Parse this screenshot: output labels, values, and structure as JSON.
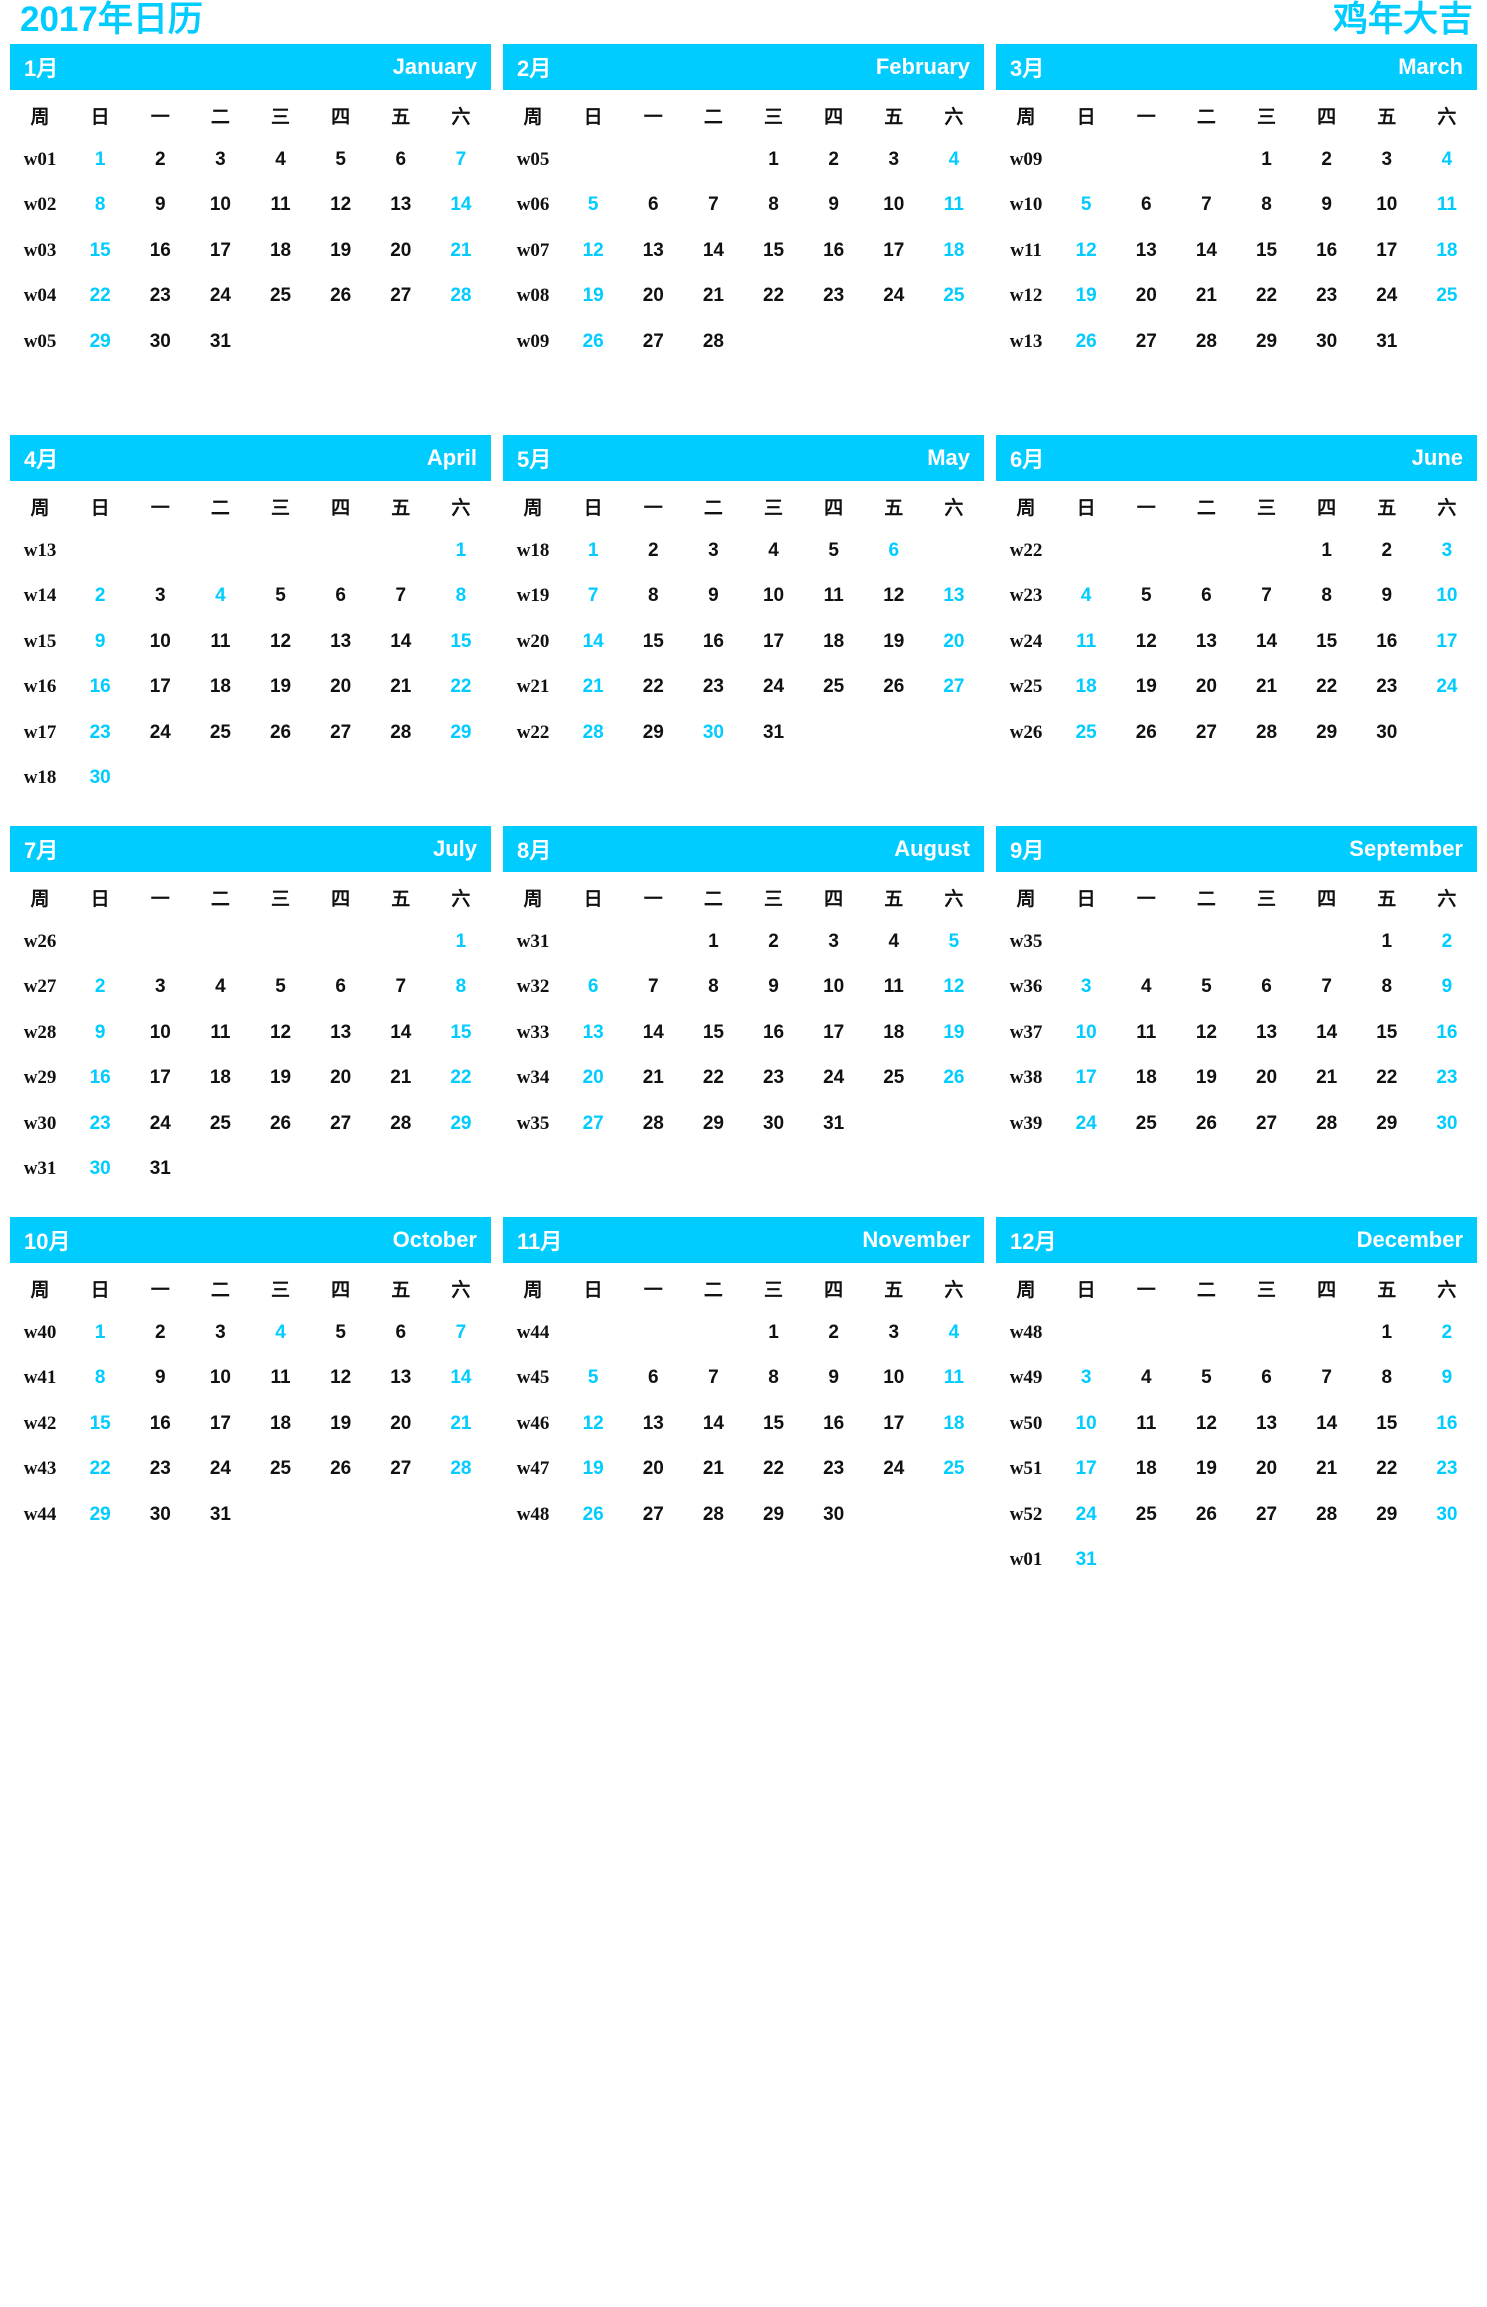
{
  "header": {
    "title_left": "2017年日历",
    "title_right": "鸡年大吉",
    "accent_color": "#00ccff",
    "text_color": "#111111"
  },
  "dow_header": {
    "week_label": "周",
    "days": [
      {
        "label": "日",
        "weekend": true
      },
      {
        "label": "一",
        "weekend": false
      },
      {
        "label": "二",
        "weekend": false
      },
      {
        "label": "三",
        "weekend": false
      },
      {
        "label": "四",
        "weekend": false
      },
      {
        "label": "五",
        "weekend": false
      },
      {
        "label": "六",
        "weekend": true
      }
    ]
  },
  "months": [
    {
      "cn": "1月",
      "en": "January",
      "rows": [
        {
          "week": "w01",
          "days": [
            "1",
            "2",
            "3",
            "4",
            "5",
            "6",
            "7"
          ],
          "hl": [
            0,
            6
          ]
        },
        {
          "week": "w02",
          "days": [
            "8",
            "9",
            "10",
            "11",
            "12",
            "13",
            "14"
          ],
          "hl": [
            0,
            6
          ]
        },
        {
          "week": "w03",
          "days": [
            "15",
            "16",
            "17",
            "18",
            "19",
            "20",
            "21"
          ],
          "hl": [
            0,
            6
          ]
        },
        {
          "week": "w04",
          "days": [
            "22",
            "23",
            "24",
            "25",
            "26",
            "27",
            "28"
          ],
          "hl": [
            0,
            6
          ]
        },
        {
          "week": "w05",
          "days": [
            "29",
            "30",
            "31",
            "",
            "",
            "",
            ""
          ],
          "hl": [
            0
          ]
        },
        {
          "week": "",
          "days": [
            "",
            "",
            "",
            "",
            "",
            "",
            ""
          ],
          "hl": []
        }
      ]
    },
    {
      "cn": "2月",
      "en": "February",
      "rows": [
        {
          "week": "w05",
          "days": [
            "",
            "",
            "",
            "1",
            "2",
            "3",
            "4"
          ],
          "hl": [
            6
          ]
        },
        {
          "week": "w06",
          "days": [
            "5",
            "6",
            "7",
            "8",
            "9",
            "10",
            "11"
          ],
          "hl": [
            0,
            6
          ]
        },
        {
          "week": "w07",
          "days": [
            "12",
            "13",
            "14",
            "15",
            "16",
            "17",
            "18"
          ],
          "hl": [
            0,
            6
          ]
        },
        {
          "week": "w08",
          "days": [
            "19",
            "20",
            "21",
            "22",
            "23",
            "24",
            "25"
          ],
          "hl": [
            0,
            6
          ]
        },
        {
          "week": "w09",
          "days": [
            "26",
            "27",
            "28",
            "",
            "",
            "",
            ""
          ],
          "hl": [
            0
          ]
        },
        {
          "week": "",
          "days": [
            "",
            "",
            "",
            "",
            "",
            "",
            ""
          ],
          "hl": []
        }
      ]
    },
    {
      "cn": "3月",
      "en": "March",
      "rows": [
        {
          "week": "w09",
          "days": [
            "",
            "",
            "",
            "1",
            "2",
            "3",
            "4"
          ],
          "hl": [
            6
          ]
        },
        {
          "week": "w10",
          "days": [
            "5",
            "6",
            "7",
            "8",
            "9",
            "10",
            "11"
          ],
          "hl": [
            0,
            6
          ]
        },
        {
          "week": "w11",
          "days": [
            "12",
            "13",
            "14",
            "15",
            "16",
            "17",
            "18"
          ],
          "hl": [
            0,
            6
          ]
        },
        {
          "week": "w12",
          "days": [
            "19",
            "20",
            "21",
            "22",
            "23",
            "24",
            "25"
          ],
          "hl": [
            0,
            6
          ]
        },
        {
          "week": "w13",
          "days": [
            "26",
            "27",
            "28",
            "29",
            "30",
            "31",
            ""
          ],
          "hl": [
            0
          ]
        },
        {
          "week": "",
          "days": [
            "",
            "",
            "",
            "",
            "",
            "",
            ""
          ],
          "hl": []
        }
      ]
    },
    {
      "cn": "4月",
      "en": "April",
      "rows": [
        {
          "week": "w13",
          "days": [
            "",
            "",
            "",
            "",
            "",
            "",
            "1"
          ],
          "hl": [
            6
          ]
        },
        {
          "week": "w14",
          "days": [
            "2",
            "3",
            "4",
            "5",
            "6",
            "7",
            "8"
          ],
          "hl": [
            0,
            2,
            6
          ]
        },
        {
          "week": "w15",
          "days": [
            "9",
            "10",
            "11",
            "12",
            "13",
            "14",
            "15"
          ],
          "hl": [
            0,
            6
          ]
        },
        {
          "week": "w16",
          "days": [
            "16",
            "17",
            "18",
            "19",
            "20",
            "21",
            "22"
          ],
          "hl": [
            0,
            6
          ]
        },
        {
          "week": "w17",
          "days": [
            "23",
            "24",
            "25",
            "26",
            "27",
            "28",
            "29"
          ],
          "hl": [
            0,
            6
          ]
        },
        {
          "week": "w18",
          "days": [
            "30",
            "",
            "",
            "",
            "",
            "",
            ""
          ],
          "hl": [
            0
          ]
        }
      ]
    },
    {
      "cn": "5月",
      "en": "May",
      "rows": [
        {
          "week": "w18",
          "days": [
            "1",
            "2",
            "3",
            "4",
            "5",
            "6",
            ""
          ],
          "hl": [
            0,
            5
          ]
        },
        {
          "week": "w19",
          "days": [
            "7",
            "8",
            "9",
            "10",
            "11",
            "12",
            "13"
          ],
          "hl": [
            0,
            6
          ]
        },
        {
          "week": "w20",
          "days": [
            "14",
            "15",
            "16",
            "17",
            "18",
            "19",
            "20"
          ],
          "hl": [
            0,
            6
          ]
        },
        {
          "week": "w21",
          "days": [
            "21",
            "22",
            "23",
            "24",
            "25",
            "26",
            "27"
          ],
          "hl": [
            0,
            6
          ]
        },
        {
          "week": "w22",
          "days": [
            "28",
            "29",
            "30",
            "31",
            "",
            "",
            ""
          ],
          "hl": [
            0,
            2
          ]
        },
        {
          "week": "",
          "days": [
            "",
            "",
            "",
            "",
            "",
            "",
            ""
          ],
          "hl": []
        }
      ]
    },
    {
      "cn": "6月",
      "en": "June",
      "rows": [
        {
          "week": "w22",
          "days": [
            "",
            "",
            "",
            "",
            "1",
            "2",
            "3"
          ],
          "hl": [
            6
          ]
        },
        {
          "week": "w23",
          "days": [
            "4",
            "5",
            "6",
            "7",
            "8",
            "9",
            "10"
          ],
          "hl": [
            0,
            6
          ]
        },
        {
          "week": "w24",
          "days": [
            "11",
            "12",
            "13",
            "14",
            "15",
            "16",
            "17"
          ],
          "hl": [
            0,
            6
          ]
        },
        {
          "week": "w25",
          "days": [
            "18",
            "19",
            "20",
            "21",
            "22",
            "23",
            "24"
          ],
          "hl": [
            0,
            6
          ]
        },
        {
          "week": "w26",
          "days": [
            "25",
            "26",
            "27",
            "28",
            "29",
            "30",
            ""
          ],
          "hl": [
            0
          ]
        },
        {
          "week": "",
          "days": [
            "",
            "",
            "",
            "",
            "",
            "",
            ""
          ],
          "hl": []
        }
      ]
    },
    {
      "cn": "7月",
      "en": "July",
      "rows": [
        {
          "week": "w26",
          "days": [
            "",
            "",
            "",
            "",
            "",
            "",
            "1"
          ],
          "hl": [
            6
          ]
        },
        {
          "week": "w27",
          "days": [
            "2",
            "3",
            "4",
            "5",
            "6",
            "7",
            "8"
          ],
          "hl": [
            0,
            6
          ]
        },
        {
          "week": "w28",
          "days": [
            "9",
            "10",
            "11",
            "12",
            "13",
            "14",
            "15"
          ],
          "hl": [
            0,
            6
          ]
        },
        {
          "week": "w29",
          "days": [
            "16",
            "17",
            "18",
            "19",
            "20",
            "21",
            "22"
          ],
          "hl": [
            0,
            6
          ]
        },
        {
          "week": "w30",
          "days": [
            "23",
            "24",
            "25",
            "26",
            "27",
            "28",
            "29"
          ],
          "hl": [
            0,
            6
          ]
        },
        {
          "week": "w31",
          "days": [
            "30",
            "31",
            "",
            "",
            "",
            "",
            ""
          ],
          "hl": [
            0
          ]
        }
      ]
    },
    {
      "cn": "8月",
      "en": "August",
      "rows": [
        {
          "week": "w31",
          "days": [
            "",
            "",
            "1",
            "2",
            "3",
            "4",
            "5"
          ],
          "hl": [
            6
          ]
        },
        {
          "week": "w32",
          "days": [
            "6",
            "7",
            "8",
            "9",
            "10",
            "11",
            "12"
          ],
          "hl": [
            0,
            6
          ]
        },
        {
          "week": "w33",
          "days": [
            "13",
            "14",
            "15",
            "16",
            "17",
            "18",
            "19"
          ],
          "hl": [
            0,
            6
          ]
        },
        {
          "week": "w34",
          "days": [
            "20",
            "21",
            "22",
            "23",
            "24",
            "25",
            "26"
          ],
          "hl": [
            0,
            6
          ]
        },
        {
          "week": "w35",
          "days": [
            "27",
            "28",
            "29",
            "30",
            "31",
            "",
            ""
          ],
          "hl": [
            0
          ]
        },
        {
          "week": "",
          "days": [
            "",
            "",
            "",
            "",
            "",
            "",
            ""
          ],
          "hl": []
        }
      ]
    },
    {
      "cn": "9月",
      "en": "September",
      "rows": [
        {
          "week": "w35",
          "days": [
            "",
            "",
            "",
            "",
            "",
            "1",
            "2"
          ],
          "hl": [
            6
          ]
        },
        {
          "week": "w36",
          "days": [
            "3",
            "4",
            "5",
            "6",
            "7",
            "8",
            "9"
          ],
          "hl": [
            0,
            6
          ]
        },
        {
          "week": "w37",
          "days": [
            "10",
            "11",
            "12",
            "13",
            "14",
            "15",
            "16"
          ],
          "hl": [
            0,
            6
          ]
        },
        {
          "week": "w38",
          "days": [
            "17",
            "18",
            "19",
            "20",
            "21",
            "22",
            "23"
          ],
          "hl": [
            0,
            6
          ]
        },
        {
          "week": "w39",
          "days": [
            "24",
            "25",
            "26",
            "27",
            "28",
            "29",
            "30"
          ],
          "hl": [
            0,
            6
          ]
        },
        {
          "week": "",
          "days": [
            "",
            "",
            "",
            "",
            "",
            "",
            ""
          ],
          "hl": []
        }
      ]
    },
    {
      "cn": "10月",
      "en": "October",
      "rows": [
        {
          "week": "w40",
          "days": [
            "1",
            "2",
            "3",
            "4",
            "5",
            "6",
            "7"
          ],
          "hl": [
            0,
            3,
            6
          ]
        },
        {
          "week": "w41",
          "days": [
            "8",
            "9",
            "10",
            "11",
            "12",
            "13",
            "14"
          ],
          "hl": [
            0,
            6
          ]
        },
        {
          "week": "w42",
          "days": [
            "15",
            "16",
            "17",
            "18",
            "19",
            "20",
            "21"
          ],
          "hl": [
            0,
            6
          ]
        },
        {
          "week": "w43",
          "days": [
            "22",
            "23",
            "24",
            "25",
            "26",
            "27",
            "28"
          ],
          "hl": [
            0,
            6
          ]
        },
        {
          "week": "w44",
          "days": [
            "29",
            "30",
            "31",
            "",
            "",
            "",
            ""
          ],
          "hl": [
            0
          ]
        },
        {
          "week": "",
          "days": [
            "",
            "",
            "",
            "",
            "",
            "",
            ""
          ],
          "hl": []
        }
      ]
    },
    {
      "cn": "11月",
      "en": "November",
      "rows": [
        {
          "week": "w44",
          "days": [
            "",
            "",
            "",
            "1",
            "2",
            "3",
            "4"
          ],
          "hl": [
            6
          ]
        },
        {
          "week": "w45",
          "days": [
            "5",
            "6",
            "7",
            "8",
            "9",
            "10",
            "11"
          ],
          "hl": [
            0,
            6
          ]
        },
        {
          "week": "w46",
          "days": [
            "12",
            "13",
            "14",
            "15",
            "16",
            "17",
            "18"
          ],
          "hl": [
            0,
            6
          ]
        },
        {
          "week": "w47",
          "days": [
            "19",
            "20",
            "21",
            "22",
            "23",
            "24",
            "25"
          ],
          "hl": [
            0,
            6
          ]
        },
        {
          "week": "w48",
          "days": [
            "26",
            "27",
            "28",
            "29",
            "30",
            "",
            ""
          ],
          "hl": [
            0
          ]
        },
        {
          "week": "",
          "days": [
            "",
            "",
            "",
            "",
            "",
            "",
            ""
          ],
          "hl": []
        }
      ]
    },
    {
      "cn": "12月",
      "en": "December",
      "rows": [
        {
          "week": "w48",
          "days": [
            "",
            "",
            "",
            "",
            "",
            "1",
            "2"
          ],
          "hl": [
            6
          ]
        },
        {
          "week": "w49",
          "days": [
            "3",
            "4",
            "5",
            "6",
            "7",
            "8",
            "9"
          ],
          "hl": [
            0,
            6
          ]
        },
        {
          "week": "w50",
          "days": [
            "10",
            "11",
            "12",
            "13",
            "14",
            "15",
            "16"
          ],
          "hl": [
            0,
            6
          ]
        },
        {
          "week": "w51",
          "days": [
            "17",
            "18",
            "19",
            "20",
            "21",
            "22",
            "23"
          ],
          "hl": [
            0,
            6
          ]
        },
        {
          "week": "w52",
          "days": [
            "24",
            "25",
            "26",
            "27",
            "28",
            "29",
            "30"
          ],
          "hl": [
            0,
            6
          ]
        },
        {
          "week": "w01",
          "days": [
            "31",
            "",
            "",
            "",
            "",
            "",
            ""
          ],
          "hl": [
            0
          ]
        }
      ]
    }
  ]
}
